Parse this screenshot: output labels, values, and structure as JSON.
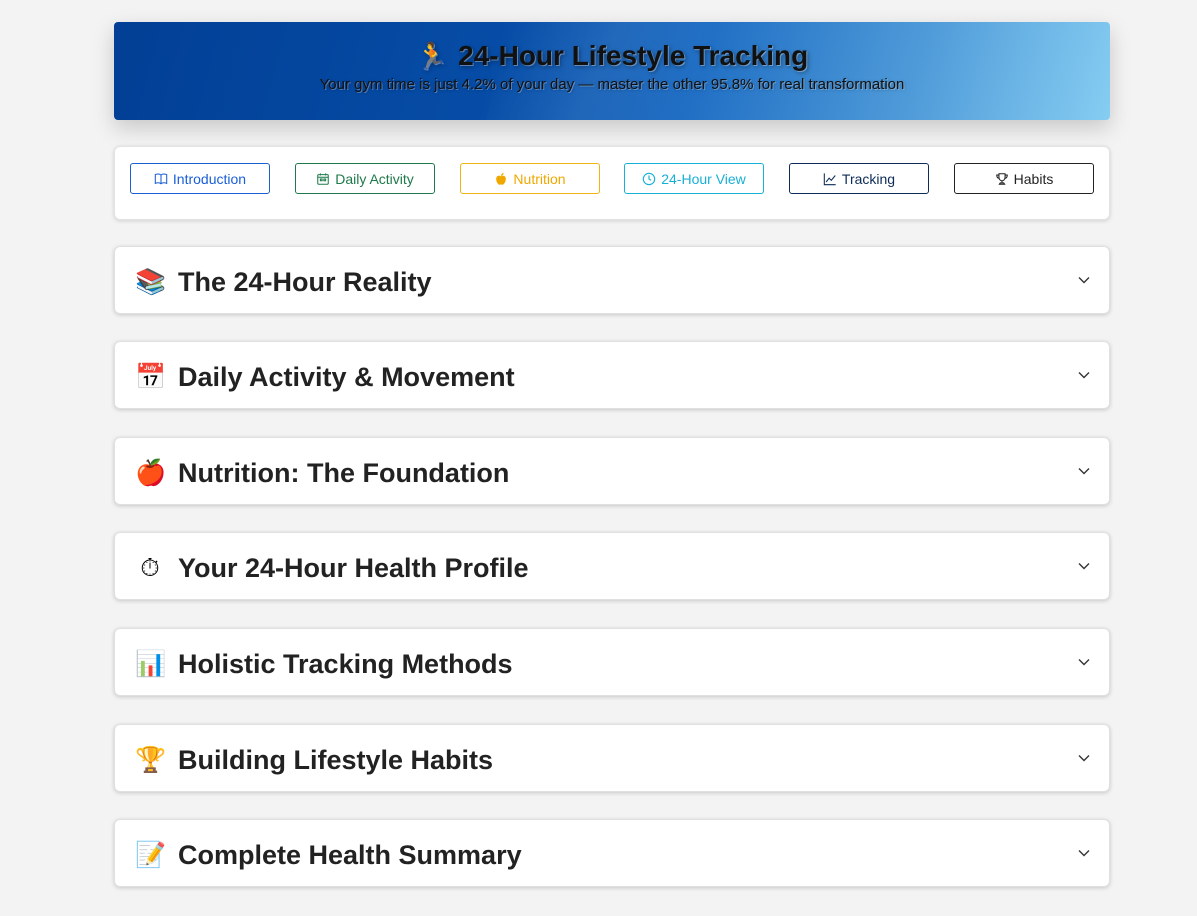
{
  "hero": {
    "icon": "running-person-icon",
    "emoji": "🏃",
    "title": "24-Hour Lifestyle Tracking",
    "subtitle": "Your gym time is just 4.2% of your day — master the other 95.8% for real transformation"
  },
  "nav": {
    "buttons": [
      {
        "label": "Introduction",
        "icon": "book-icon",
        "color": "#1a5fd6"
      },
      {
        "label": "Daily Activity",
        "icon": "calendar-icon",
        "color": "#1e7a4a"
      },
      {
        "label": "Nutrition",
        "icon": "apple-icon",
        "color": "#f0a800"
      },
      {
        "label": "24-Hour View",
        "icon": "clock-icon",
        "color": "#17b0d6"
      },
      {
        "label": "Tracking",
        "icon": "chart-line-icon",
        "color": "#0d2c58"
      },
      {
        "label": "Habits",
        "icon": "trophy-icon",
        "color": "#222222"
      }
    ]
  },
  "sections": [
    {
      "emoji": "📚",
      "icon": "books-icon",
      "title": "The 24-Hour Reality"
    },
    {
      "emoji": "📅",
      "icon": "calendar-icon",
      "title": "Daily Activity & Movement"
    },
    {
      "emoji": "🍎",
      "icon": "apple-icon",
      "title": "Nutrition: The Foundation"
    },
    {
      "emoji": "⏱",
      "icon": "stopwatch-icon",
      "title": "Your 24-Hour Health Profile"
    },
    {
      "emoji": "📊",
      "icon": "bar-chart-icon",
      "title": "Holistic Tracking Methods"
    },
    {
      "emoji": "🏆",
      "icon": "trophy-icon",
      "title": "Building Lifestyle Habits"
    },
    {
      "emoji": "📝",
      "icon": "memo-icon",
      "title": "Complete Health Summary"
    }
  ]
}
